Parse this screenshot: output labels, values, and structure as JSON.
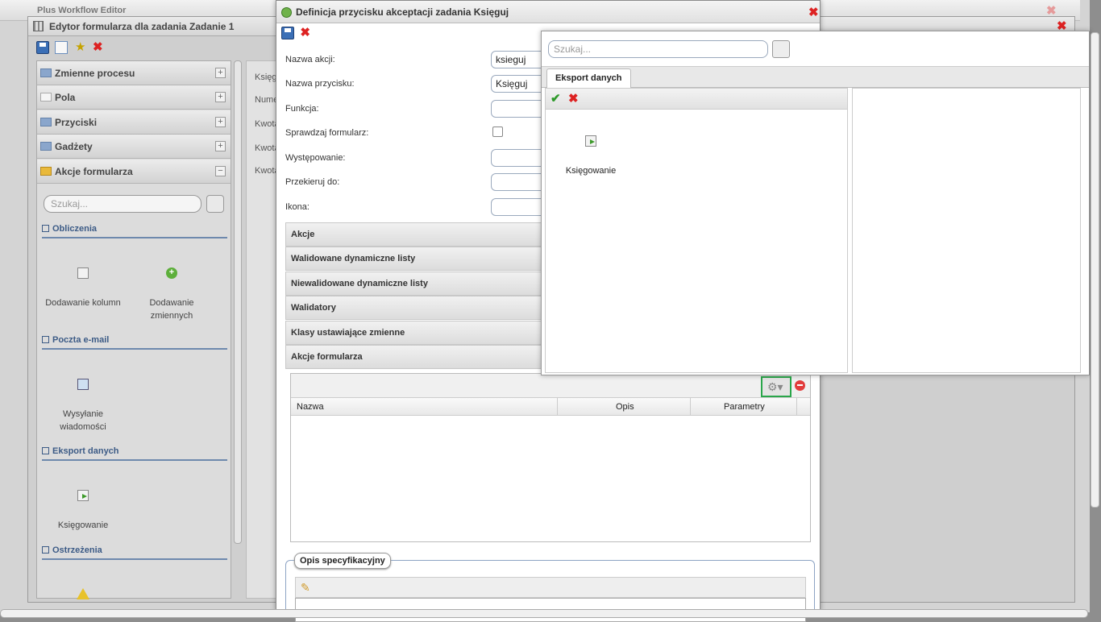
{
  "app": {
    "title": "Plus Workflow Editor"
  },
  "editor": {
    "title": "Edytor formularza dla zadania Zadanie 1",
    "sections": [
      "Zmienne procesu",
      "Pola",
      "Przyciski",
      "Gadżety",
      "Akcje formularza"
    ],
    "search_placeholder": "Szukaj...",
    "groups": {
      "obliczenia": "Obliczenia",
      "poczta": "Poczta e-mail",
      "eksport": "Eksport danych",
      "ostrzezenia": "Ostrzeżenia"
    },
    "items": {
      "dodawanie_kolumn": "Dodawanie kolumn",
      "dodawanie_zmiennych": "Dodawanie zmiennych",
      "wysylanie": "Wysyłanie wiadomości",
      "ksiegowanie": "Księgowanie"
    },
    "side_labels": [
      "Księg",
      "Numer",
      "Kwota",
      "Kwota",
      "Kwota"
    ]
  },
  "dialog": {
    "title": "Definicja przycisku akceptacji zadania Księguj",
    "fields": {
      "nazwa_akcji": {
        "label": "Nazwa akcji:",
        "value": "ksieguj"
      },
      "nazwa_przycisku": {
        "label": "Nazwa przycisku:",
        "value": "Księguj"
      },
      "funkcja": {
        "label": "Funkcja:",
        "value": ""
      },
      "sprawdzaj": {
        "label": "Sprawdzaj formularz:"
      },
      "wystepowanie": {
        "label": "Występowanie:",
        "value": ""
      },
      "przekieruj": {
        "label": "Przekieruj do:",
        "value": ""
      },
      "ikona": {
        "label": "Ikona:",
        "value": ""
      }
    },
    "sections": [
      "Akcje",
      "Walidowane dynamiczne listy",
      "Niewalidowane dynamiczne listy",
      "Walidatory",
      "Klasy ustawiające zmienne",
      "Akcje formularza"
    ],
    "grid_columns": {
      "nazwa": "Nazwa",
      "opis": "Opis",
      "parametry": "Parametry"
    },
    "opis_legend": "Opis specyfikacyjny"
  },
  "popup": {
    "search_placeholder": "Szukaj...",
    "tab": "Eksport danych",
    "item": "Księgowanie"
  }
}
